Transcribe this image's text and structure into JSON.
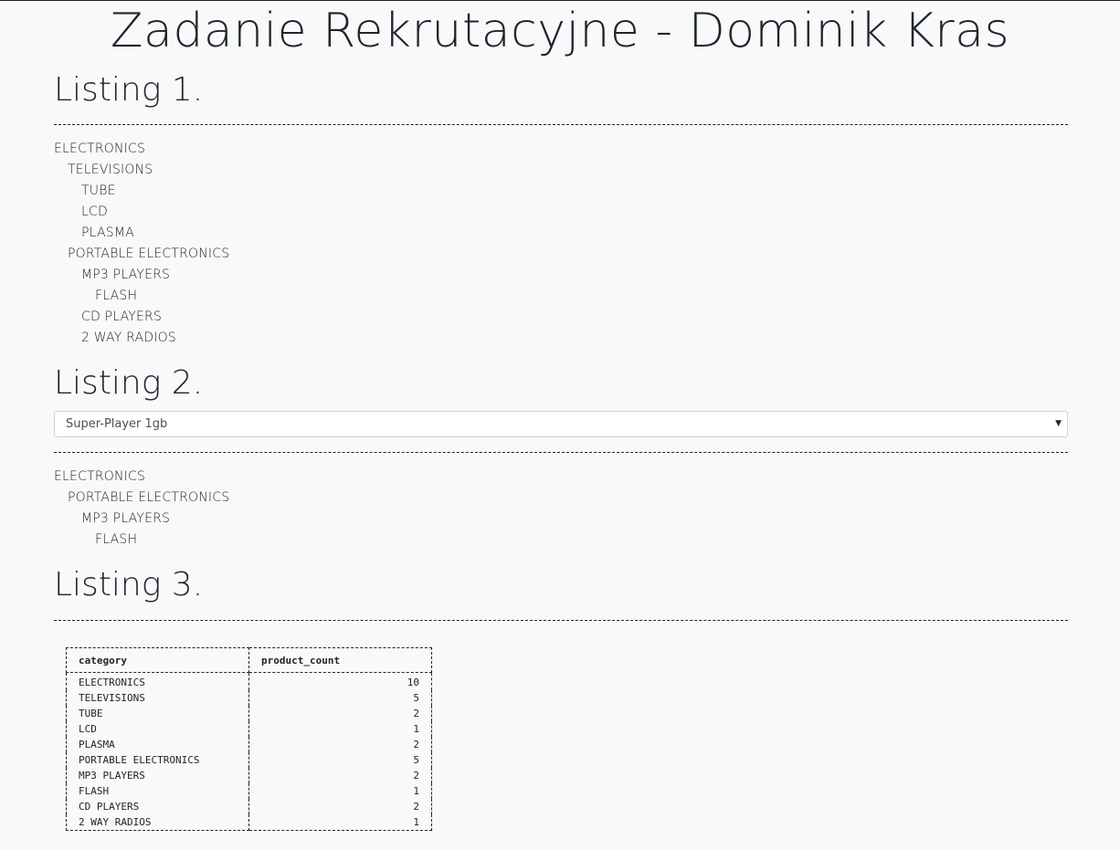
{
  "page_title": "Zadanie Rekrutacyjne - Dominik Kras",
  "listing1": {
    "heading": "Listing 1.",
    "tree": [
      {
        "label": "ELECTRONICS",
        "depth": 0
      },
      {
        "label": "TELEVISIONS",
        "depth": 1
      },
      {
        "label": "TUBE",
        "depth": 2
      },
      {
        "label": "LCD",
        "depth": 2
      },
      {
        "label": "PLASMA",
        "depth": 2
      },
      {
        "label": "PORTABLE ELECTRONICS",
        "depth": 1
      },
      {
        "label": "MP3 PLAYERS",
        "depth": 2
      },
      {
        "label": "FLASH",
        "depth": 3
      },
      {
        "label": "CD PLAYERS",
        "depth": 2
      },
      {
        "label": "2 WAY RADIOS",
        "depth": 2
      }
    ]
  },
  "listing2": {
    "heading": "Listing 2.",
    "select": {
      "selected": "Super-Player 1gb",
      "arrow_icon": "caret-down-icon"
    },
    "tree": [
      {
        "label": "ELECTRONICS",
        "depth": 0
      },
      {
        "label": "PORTABLE ELECTRONICS",
        "depth": 1
      },
      {
        "label": "MP3 PLAYERS",
        "depth": 2
      },
      {
        "label": "FLASH",
        "depth": 3
      }
    ]
  },
  "listing3": {
    "heading": "Listing 3.",
    "table": {
      "columns": [
        "category",
        "product_count"
      ],
      "rows": [
        [
          "ELECTRONICS",
          "10"
        ],
        [
          "TELEVISIONS",
          "5"
        ],
        [
          "TUBE",
          "2"
        ],
        [
          "LCD",
          "1"
        ],
        [
          "PLASMA",
          "2"
        ],
        [
          "PORTABLE ELECTRONICS",
          "5"
        ],
        [
          "MP3 PLAYERS",
          "2"
        ],
        [
          "FLASH",
          "1"
        ],
        [
          "CD PLAYERS",
          "2"
        ],
        [
          "2 WAY RADIOS",
          "1"
        ]
      ]
    }
  }
}
